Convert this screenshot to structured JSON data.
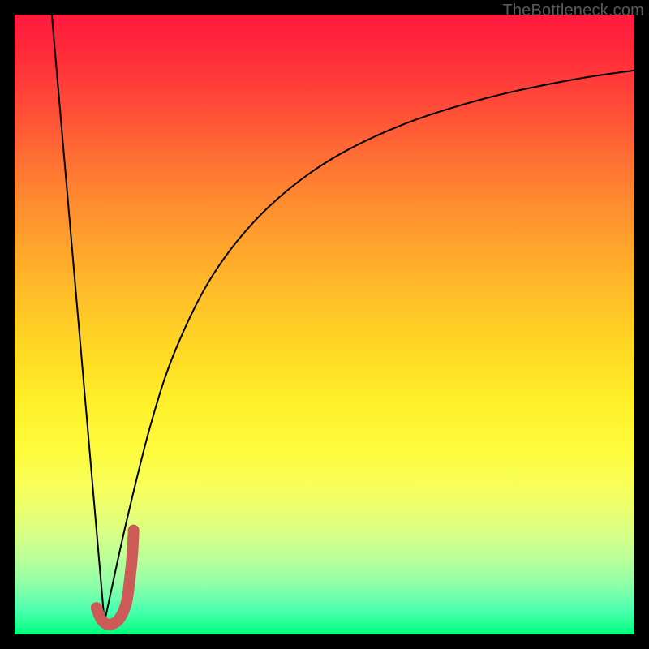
{
  "credit_text": "TheBottleneck.com",
  "gradient_colors": {
    "top": "#ff1a3c",
    "middle": "#ffee28",
    "bottom": "#00ff7f"
  },
  "chart_data": {
    "type": "line",
    "title": "",
    "xlabel": "",
    "ylabel": "",
    "xlim": [
      0,
      100
    ],
    "ylim": [
      0,
      100
    ],
    "series": [
      {
        "name": "left-descent",
        "color": "#000000",
        "width": 2,
        "x": [
          6.0,
          14.5
        ],
        "y": [
          100,
          2
        ]
      },
      {
        "name": "right-ascent",
        "color": "#000000",
        "width": 2,
        "x": [
          14.5,
          18,
          22,
          26,
          32,
          40,
          50,
          62,
          76,
          90,
          100
        ],
        "y": [
          2,
          18,
          34,
          46,
          58,
          68,
          76,
          82,
          86.5,
          89.5,
          91
        ]
      },
      {
        "name": "j-mark",
        "color": "#cc5b57",
        "width": 14,
        "x": [
          13.2,
          14.0,
          15.2,
          16.8,
          18.0,
          18.6,
          19.0,
          19.2
        ],
        "y": [
          4.3,
          2.4,
          1.6,
          2.4,
          5.0,
          9.0,
          13.0,
          16.8
        ]
      }
    ],
    "background_gradient": {
      "direction": "vertical",
      "stops": [
        {
          "pos": 0.0,
          "color": "#ff1a3c"
        },
        {
          "pos": 0.3,
          "color": "#ff8a30"
        },
        {
          "pos": 0.62,
          "color": "#ffee28"
        },
        {
          "pos": 0.84,
          "color": "#d6ff86"
        },
        {
          "pos": 1.0,
          "color": "#00ff7f"
        }
      ]
    }
  }
}
